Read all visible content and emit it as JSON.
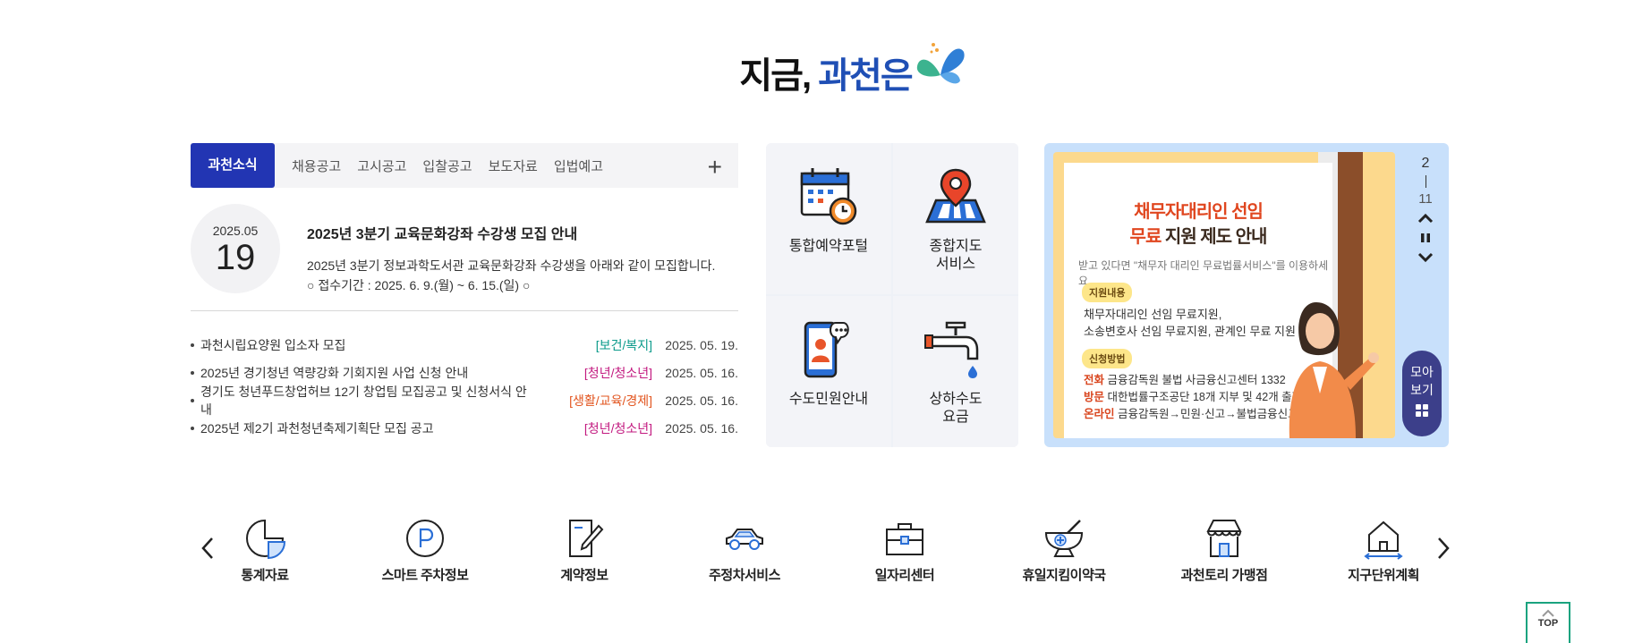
{
  "header": {
    "title_part1": "지금,",
    "title_part2": "과천은"
  },
  "news": {
    "tabs": [
      "과천소식",
      "채용공고",
      "고시공고",
      "입찰공고",
      "보도자료",
      "입법예고"
    ],
    "active_tab": "과천소식",
    "more_icon": "plus-icon",
    "feature": {
      "year_month": "2025.05",
      "day": "19",
      "title": "2025년 3분기 교육문화강좌 수강생 모집 안내",
      "body_line1": "2025년 3분기 정보과학도서관 교육문화강좌 수강생을 아래와 같이 모집합니다.",
      "body_line2": "○ 접수기간 : 2025. 6. 9.(월) ~ 6. 15.(일) ○"
    },
    "items": [
      {
        "title": "과천시립요양원 입소자 모집",
        "category": "[보건/복지]",
        "category_color": "#0a9a8a",
        "date": "2025. 05. 19."
      },
      {
        "title": "2025년 경기청년 역량강화 기회지원 사업 신청 안내",
        "category": "[청년/청소년]",
        "category_color": "#c2187f",
        "date": "2025. 05. 16."
      },
      {
        "title": "경기도 청년푸드창업허브 12기 창업팀 모집공고 및 신청서식 안내",
        "category": "[생활/교육/경제]",
        "category_color": "#e2541e",
        "date": "2025. 05. 16."
      },
      {
        "title": "2025년 제2기 과천청년축제기획단 모집 공고",
        "category": "[청년/청소년]",
        "category_color": "#c2187f",
        "date": "2025. 05. 16."
      }
    ]
  },
  "services": [
    {
      "label": "통합예약포털",
      "icon": "calendar-clock-icon"
    },
    {
      "label": "종합지도\n서비스",
      "icon": "map-pin-icon"
    },
    {
      "label": "수도민원안내",
      "icon": "phone-chat-icon"
    },
    {
      "label": "상하수도\n요금",
      "icon": "faucet-icon"
    }
  ],
  "banner": {
    "headline1": "채무자대리인 선임",
    "headline2_a": "무료",
    "headline2_b": " 지원 제도 안내",
    "subtitle": "받고 있다면 \"채무자 대리인 무료법률서비스\"를 이용하세요.",
    "section1_label": "지원내용",
    "section1_line1": "채무자대리인 선임 무료지원,",
    "section1_line2": "소송변호사 선임 무료지원, 관계인 무료 지원",
    "section2_label": "신청방법",
    "method1_key": "전화",
    "method1_val": " 금융감독원 불법 사금융신고센터 1332",
    "method2_key": "방문",
    "method2_val": " 대한법률구조공단 18개 지부 및 42개 출장소",
    "method3_key": "온라인",
    "method3_val": " 금융감독원→민원·신고→불법금융신고센터",
    "current": "2",
    "total": "11",
    "more_line1": "모아",
    "more_line2": "보기"
  },
  "quick_links": [
    {
      "label": "통계자료",
      "icon": "pie-chart-icon"
    },
    {
      "label": "스마트 주차정보",
      "icon": "parking-icon"
    },
    {
      "label": "계약정보",
      "icon": "document-pen-icon"
    },
    {
      "label": "주정차서비스",
      "icon": "car-icon"
    },
    {
      "label": "일자리센터",
      "icon": "briefcase-icon"
    },
    {
      "label": "휴일지킴이약국",
      "icon": "pharmacy-bowl-icon"
    },
    {
      "label": "과천토리 가맹점",
      "icon": "store-icon"
    },
    {
      "label": "지구단위계획",
      "icon": "house-icon"
    }
  ],
  "top_button": {
    "label": "TOP"
  },
  "colors": {
    "primary": "#2235b3",
    "title_blue": "#1f4fb5",
    "banner_bg": "#c8e0fb",
    "top_border": "#1aa37f"
  }
}
